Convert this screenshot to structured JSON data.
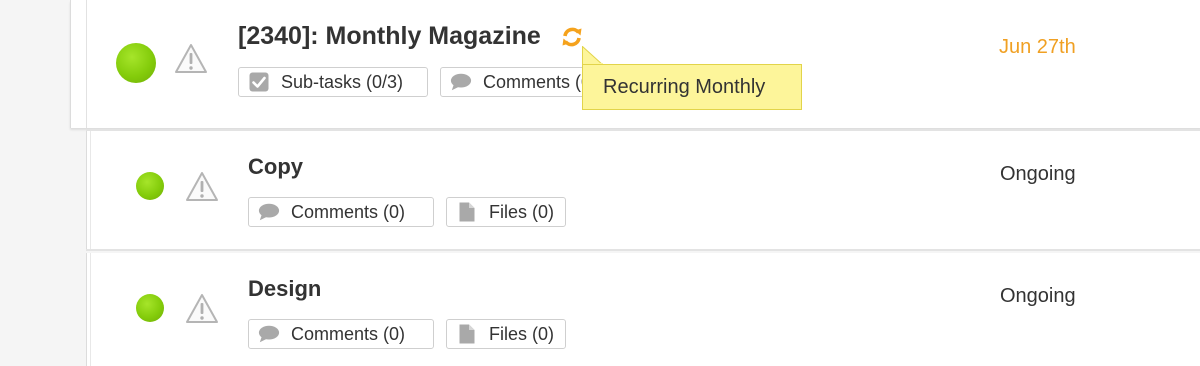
{
  "parent_task": {
    "title": "[2340]: Monthly Magazine",
    "due": "Jun 27th",
    "due_color": "#f0a023",
    "status_color": "#84cc0b",
    "icons": {
      "status": "status-dot-icon",
      "warning": "warning-icon",
      "recurring": "recurring-icon"
    },
    "chips": {
      "subtasks": "Sub-tasks (0/3)",
      "comments": "Comments (0)"
    },
    "tooltip": "Recurring Monthly"
  },
  "subtasks": [
    {
      "title": "Copy",
      "status": "Ongoing",
      "comments": "Comments (0)",
      "files": "Files (0)"
    },
    {
      "title": "Design",
      "status": "Ongoing",
      "comments": "Comments (0)",
      "files": "Files (0)"
    }
  ]
}
